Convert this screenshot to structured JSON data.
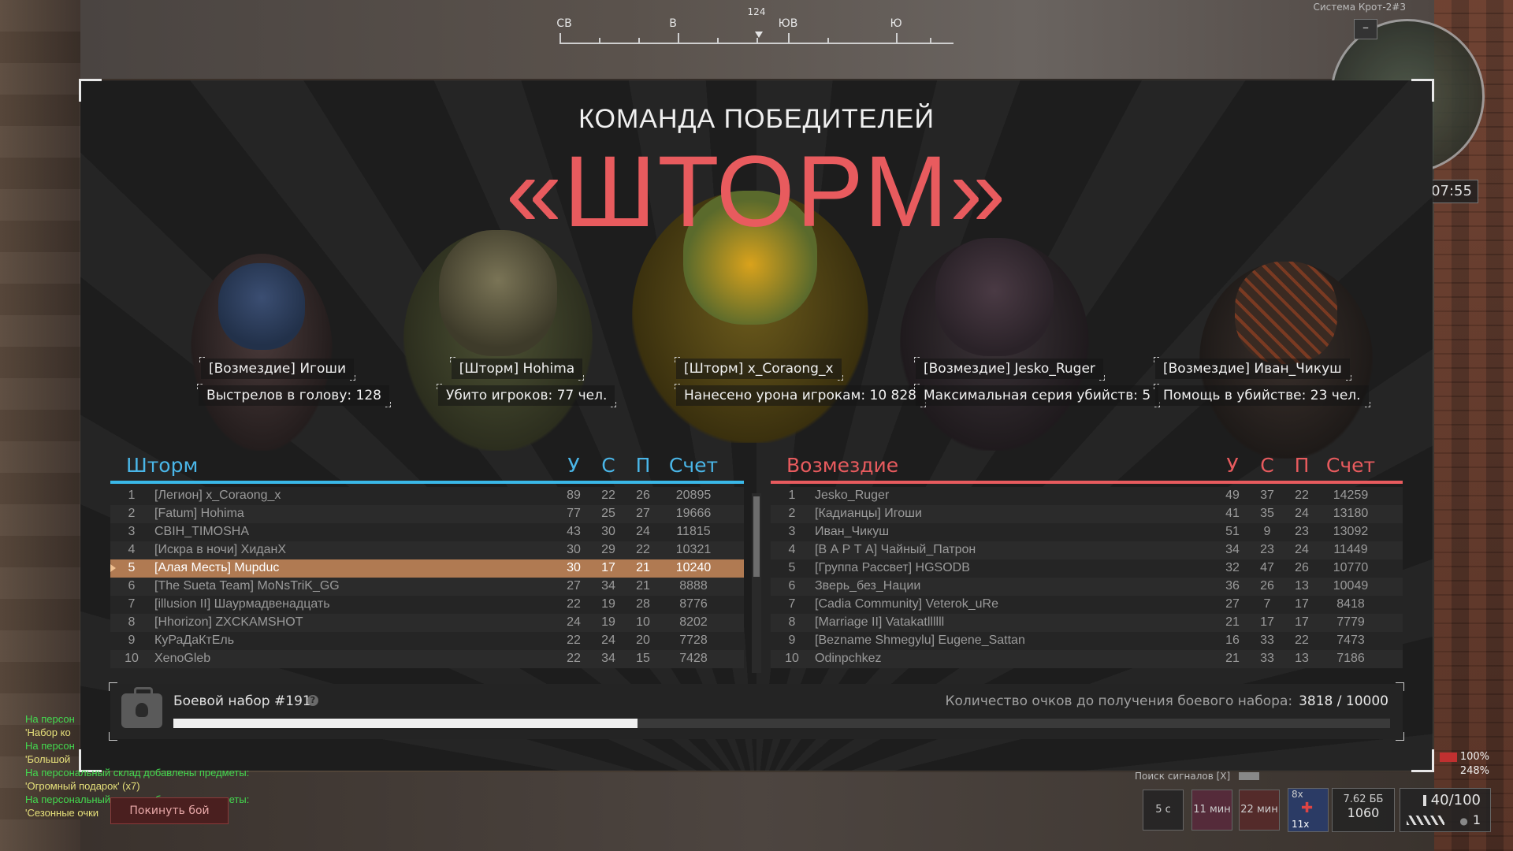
{
  "compass": {
    "heading": "124",
    "labels": [
      {
        "text": "СВ"
      },
      {
        "text": "В"
      },
      {
        "text": "ЮВ"
      },
      {
        "text": "Ю"
      }
    ]
  },
  "minimap": {
    "system_label": "Система Крот-2#3",
    "timer": "07:55",
    "button": "–"
  },
  "header": {
    "subtitle": "КОМАНДА ПОБЕДИТЕЛЕЙ",
    "team": "«ШТОРМ»"
  },
  "awards": [
    {
      "player": "[Возмездие] Игоши",
      "stat": "Выстрелов в голову: 128"
    },
    {
      "player": "[Шторм] Hohima",
      "stat": "Убито игроков: 77 чел."
    },
    {
      "player": "[Шторм] x_Coraong_x",
      "stat": "Нанесено урона игрокам: 10 828"
    },
    {
      "player": "[Возмездие] Jesko_Ruger",
      "stat": "Максимальная серия убийств: 5"
    },
    {
      "player": "[Возмездие] Иван_Чикуш",
      "stat": "Помощь в убийстве: 23 чел."
    }
  ],
  "columns": {
    "kills": "У",
    "deaths": "С",
    "assists": "П",
    "score": "Счет"
  },
  "teams": {
    "left": {
      "name": "Шторм",
      "accent": "#3ab8e8",
      "rows": [
        {
          "rank": "1",
          "name": "[Легион] x_Coraong_x",
          "k": "89",
          "d": "22",
          "a": "26",
          "score": "20895"
        },
        {
          "rank": "2",
          "name": "[Fatum] Hohima",
          "k": "77",
          "d": "25",
          "a": "27",
          "score": "19666"
        },
        {
          "rank": "3",
          "name": "CBIH_TIMOSHA",
          "k": "43",
          "d": "30",
          "a": "24",
          "score": "11815"
        },
        {
          "rank": "4",
          "name": "[Искра в ночи] ХиданХ",
          "k": "30",
          "d": "29",
          "a": "22",
          "score": "10321"
        },
        {
          "rank": "5",
          "name": "[Алая Месть] Mupduc",
          "k": "30",
          "d": "17",
          "a": "21",
          "score": "10240",
          "me": true
        },
        {
          "rank": "6",
          "name": "[The Sueta Team] MoNsTriK_GG",
          "k": "27",
          "d": "34",
          "a": "21",
          "score": "8888"
        },
        {
          "rank": "7",
          "name": "[illusion II] Шаурмадвенадцать",
          "k": "22",
          "d": "19",
          "a": "28",
          "score": "8776"
        },
        {
          "rank": "8",
          "name": "[Hhorizon] ZXCKAMSHOT",
          "k": "24",
          "d": "19",
          "a": "10",
          "score": "8202"
        },
        {
          "rank": "9",
          "name": "КуРаДаКтЕль",
          "k": "22",
          "d": "24",
          "a": "20",
          "score": "7728"
        },
        {
          "rank": "10",
          "name": "XenoGleb",
          "k": "22",
          "d": "34",
          "a": "15",
          "score": "7428"
        }
      ]
    },
    "right": {
      "name": "Возмездие",
      "accent": "#e85b5e",
      "rows": [
        {
          "rank": "1",
          "name": "Jesko_Ruger",
          "k": "49",
          "d": "37",
          "a": "22",
          "score": "14259"
        },
        {
          "rank": "2",
          "name": "[Кадианцы] Игоши",
          "k": "41",
          "d": "35",
          "a": "24",
          "score": "13180"
        },
        {
          "rank": "3",
          "name": "Иван_Чикуш",
          "k": "51",
          "d": "9",
          "a": "23",
          "score": "13092"
        },
        {
          "rank": "4",
          "name": "[В А Р Т А] Чайный_Патрон",
          "k": "34",
          "d": "23",
          "a": "24",
          "score": "11449"
        },
        {
          "rank": "5",
          "name": "[Группа Рассвет] HGSODB",
          "k": "32",
          "d": "47",
          "a": "26",
          "score": "10770"
        },
        {
          "rank": "6",
          "name": "Зверь_без_Нации",
          "k": "36",
          "d": "26",
          "a": "13",
          "score": "10049"
        },
        {
          "rank": "7",
          "name": "[Cadia Community] Veterok_uRe",
          "k": "27",
          "d": "7",
          "a": "17",
          "score": "8418"
        },
        {
          "rank": "8",
          "name": "[Marriage II] Vatakatllllll",
          "k": "21",
          "d": "17",
          "a": "17",
          "score": "7779"
        },
        {
          "rank": "9",
          "name": "[Bezname Shmegylu] Eugene_Sattan",
          "k": "16",
          "d": "33",
          "a": "22",
          "score": "7473"
        },
        {
          "rank": "10",
          "name": "Odinpchkez",
          "k": "21",
          "d": "33",
          "a": "13",
          "score": "7186"
        }
      ]
    }
  },
  "kit": {
    "title": "Боевой набор #191",
    "points_label": "Количество очков до получения боевого набора:",
    "points_value": "3818 / 10000",
    "progress": 0.3818
  },
  "chat": [
    {
      "text": "На персон",
      "cls": ""
    },
    {
      "text": "'Набор ко",
      "cls": "q"
    },
    {
      "text": "На персон",
      "cls": ""
    },
    {
      "text": "'Большой",
      "cls": "q"
    },
    {
      "text": "На персональный склад добавлены предметы:",
      "cls": ""
    },
    {
      "text": "'Огромный подарок' (x7)",
      "cls": "q"
    },
    {
      "text": "На персональный склад добавлены предметы:",
      "cls": ""
    },
    {
      "text": "'Сезонные очки",
      "cls": "q"
    }
  ],
  "leave_button": "Покинуть бой",
  "hud": {
    "signal": "Поиск сигналов [X]",
    "pct1": "100%",
    "pct2": "248%",
    "slots": [
      {
        "label": "5 с"
      },
      {
        "label": "11 мин"
      },
      {
        "label": "22 мин"
      }
    ],
    "medkit_count": "8x",
    "medkit_stack": "11x",
    "caliber": "7.62 ББ",
    "reserve": "1060",
    "ammo": "40/100",
    "grenades": "1"
  }
}
